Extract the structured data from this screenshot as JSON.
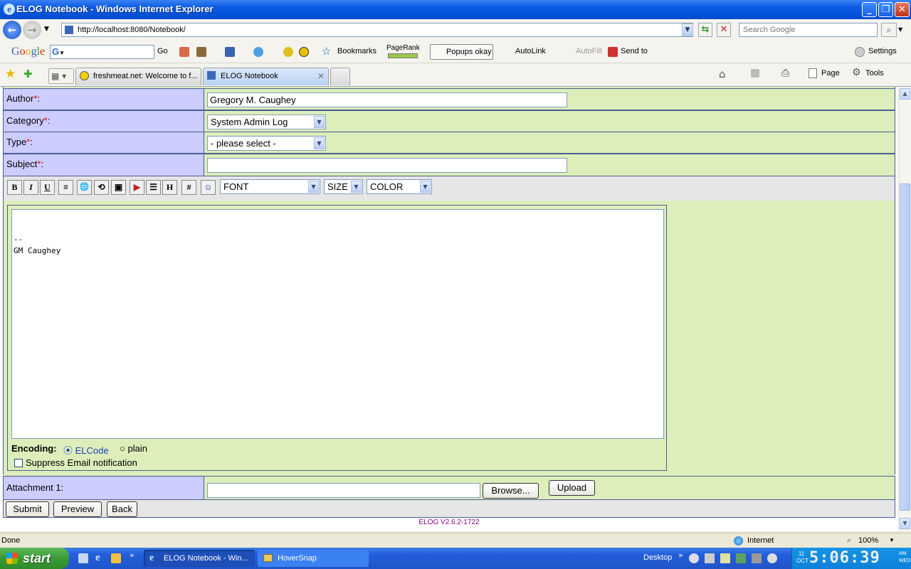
{
  "window": {
    "title": "ELOG Notebook - Windows Internet Explorer"
  },
  "address": {
    "url": "http://localhost:8080/Notebook/",
    "search_placeholder": "Search Google"
  },
  "google_toolbar": {
    "logo": "Google",
    "go": "Go",
    "bookmarks": "Bookmarks",
    "pagerank": "PageRank",
    "popups": "Popups okay",
    "autolink": "AutoLink",
    "autofill": "AutoFill",
    "sendto": "Send to",
    "settings": "Settings"
  },
  "tabs": [
    {
      "label": "freshmeat.net: Welcome to f...",
      "active": false
    },
    {
      "label": "ELOG Notebook",
      "active": true
    }
  ],
  "command_bar": {
    "page": "Page",
    "tools": "Tools"
  },
  "form": {
    "author": {
      "label": "Author",
      "value": "Gregory M. Caughey"
    },
    "category": {
      "label": "Category",
      "value": "System Admin Log"
    },
    "type": {
      "label": "Type",
      "value": "- please select -"
    },
    "subject": {
      "label": "Subject",
      "value": ""
    },
    "format_buttons": [
      "B",
      "I",
      "U",
      "≡",
      "🌐",
      "⟲",
      "▣",
      "▶",
      "☰",
      "H",
      "#",
      "☺"
    ],
    "font": "FONT",
    "size": "SIZE",
    "color": "COLOR",
    "body_text": "\n\n--\nGM Caughey",
    "encoding_label": "Encoding",
    "encoding_options": [
      "ELCode",
      "plain"
    ],
    "encoding_selected": "ELCode",
    "suppress_email": "Suppress Email notification",
    "attachment_label": "Attachment 1:",
    "browse": "Browse...",
    "upload": "Upload",
    "submit": "Submit",
    "preview": "Preview",
    "back": "Back",
    "version": "ELOG V2.6.2-1722"
  },
  "statusbar": {
    "status": "Done",
    "zone": "Internet",
    "zoom": "100%"
  },
  "taskbar": {
    "start": "start",
    "tasks": [
      "ELOG Notebook - Win...",
      "HoverSnap"
    ],
    "desktop": "Desktop",
    "clock": "5:06:39",
    "date": "11 OCT",
    "ampm": "AM WED"
  }
}
